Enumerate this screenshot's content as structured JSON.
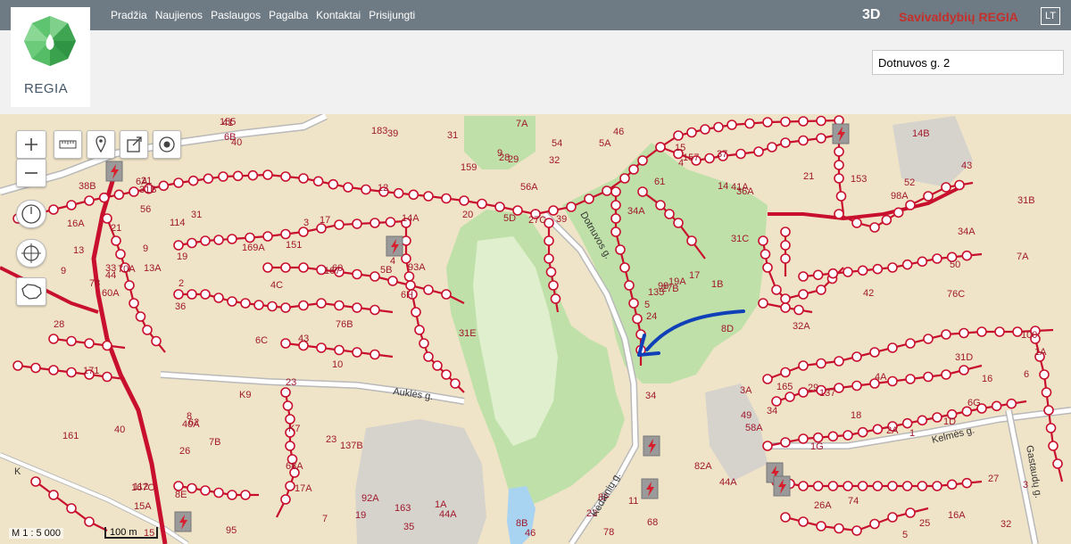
{
  "nav": {
    "items": [
      "Pradžia",
      "Naujienos",
      "Paslaugos",
      "Pagalba",
      "Kontaktai",
      "Prisijungti"
    ]
  },
  "header": {
    "three_d": "3D",
    "brand": "Savivaldybių REGIA",
    "lang": "LT",
    "logo_text": "REGIA",
    "search_value": "Dotnuvos g. 2"
  },
  "map": {
    "scale_label": "M 1 : 5 000",
    "scalebar_label": "100 m",
    "street_labels": [
      "Auklės g.",
      "Dotnuvos g.",
      "Kėdainių g.",
      "Kelmės g.",
      "Gastaudų g.",
      "K"
    ],
    "address_labels": [
      "114",
      "112",
      "135",
      "137B",
      "37",
      "39",
      "41A",
      "40",
      "32",
      "36",
      "31B",
      "31C",
      "95",
      "5D",
      "7B",
      "93A",
      "15A",
      "17A",
      "27C",
      "27B",
      "137",
      "31",
      "29",
      "60A",
      "3A",
      "7A",
      "17",
      "21",
      "23",
      "25",
      "27",
      "29",
      "46",
      "5B",
      "4C",
      "58A",
      "7",
      "9",
      "5",
      "15",
      "24",
      "26",
      "34A",
      "38B",
      "34",
      "44A",
      "68A",
      "6B",
      "52",
      "54",
      "76B",
      "70A",
      "151",
      "153",
      "155",
      "157",
      "159",
      "161",
      "163",
      "165",
      "167",
      "167C",
      "169A",
      "171",
      "8F",
      "8E",
      "8D",
      "6G",
      "8B",
      "76C",
      "74",
      "78",
      "82A",
      "9",
      "1A",
      "1B",
      "1G",
      "1D",
      "44",
      "46",
      "14",
      "36A",
      "6C",
      "183",
      "100",
      "78",
      "K9",
      "K7",
      "92A",
      "98",
      "98A",
      "6H",
      "31D",
      "31B",
      "31E",
      "39",
      "40",
      "43",
      "20",
      "31",
      "40A",
      "14B",
      "14A",
      "32A",
      "23",
      "16A",
      "44A",
      "42",
      "56",
      "62",
      "68",
      "60",
      "12",
      "16",
      "18",
      "10",
      "8",
      "6",
      "4",
      "2",
      "2A",
      "19A",
      "21",
      "1A",
      "26A",
      "28",
      "50",
      "3",
      "33",
      "35",
      "4A",
      "5A",
      "56A",
      "43",
      "34A",
      "34",
      "32",
      "28",
      "7A",
      "4",
      "9",
      "3",
      "41",
      "5",
      "1",
      "11",
      "13",
      "15",
      "17",
      "19",
      "61",
      "49",
      "16A",
      "19",
      "21",
      "23",
      "13A",
      "6A"
    ]
  },
  "controls": {
    "zoom_in": "+",
    "zoom_out": "−"
  },
  "colors": {
    "topbar": "#6f7b84",
    "brand": "#c4302b",
    "network_line": "#c8102e",
    "node_fill": "#ffffff",
    "map_background": "#f0e4c8",
    "park": "#bfe0a8",
    "water": "#a8d4f2",
    "road": "#ffffff",
    "arrow": "#1040b8"
  },
  "icons": [
    "zoom-in-icon",
    "zoom-out-icon",
    "measure-ruler-icon",
    "pin-icon",
    "export-icon",
    "locate-target-icon",
    "clock-icon",
    "crosshair-icon",
    "lithuania-outline-icon",
    "substation-lightning-icon",
    "regia-logo-icon",
    "blue-arrow-annotation-icon"
  ]
}
